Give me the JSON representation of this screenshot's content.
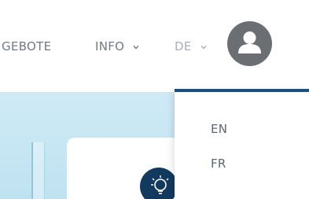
{
  "nav": {
    "offers_label": "GEBOTE",
    "info_label": "INFO",
    "language_label": "DE",
    "dropdown_icon": "chevron-down-icon",
    "avatar_icon": "user-icon"
  },
  "language_menu": {
    "options": [
      "EN",
      "FR"
    ],
    "accent_color": "#1a4f86"
  },
  "hero": {
    "badge_icon": "lightbulb-icon",
    "background_color": "#c7e6f4",
    "badge_color": "#123a5e"
  }
}
